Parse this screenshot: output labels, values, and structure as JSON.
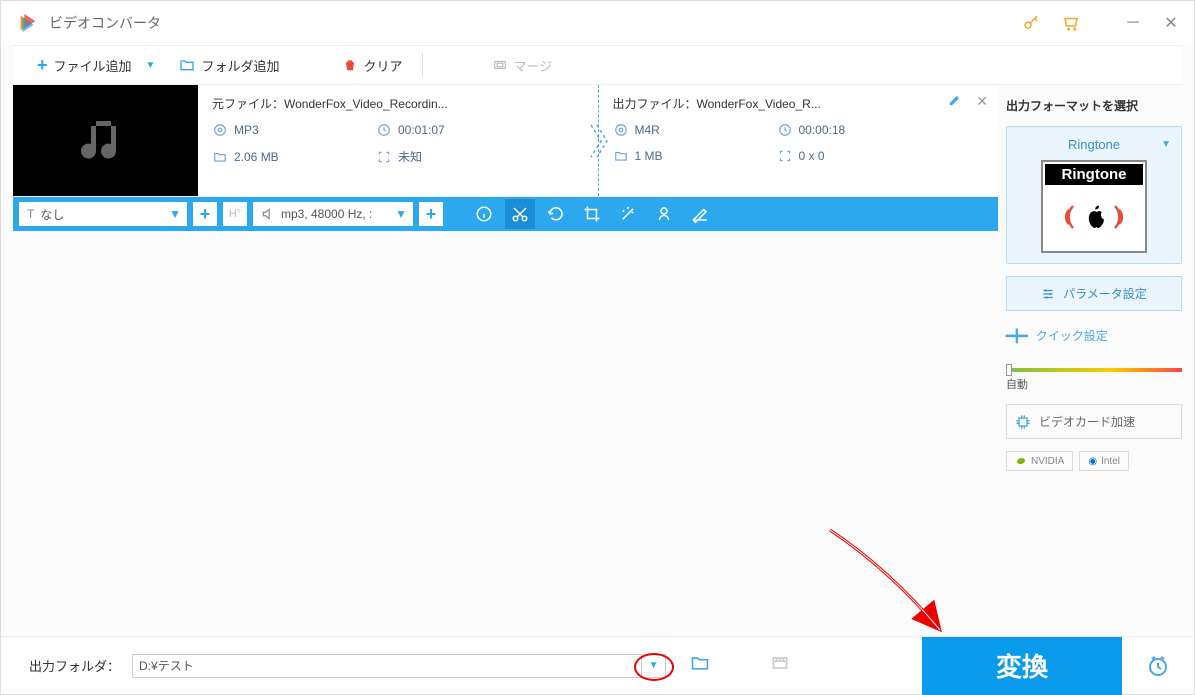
{
  "title": "ビデオコンバータ",
  "toolbar": {
    "add_file": "ファイル追加",
    "add_folder": "フォルダ追加",
    "clear": "クリア",
    "merge": "マージ"
  },
  "file": {
    "src": {
      "label": "元ファイル：",
      "name": "WonderFox_Video_Recordin...",
      "format": "MP3",
      "duration": "00:01:07",
      "size": "2.06 MB",
      "dims": "未知"
    },
    "out": {
      "label": "出力ファイル：",
      "name": "WonderFox_Video_R...",
      "format": "M4R",
      "duration": "00:00:18",
      "size": "1 MB",
      "dims": "0 x 0"
    }
  },
  "actionbar": {
    "subtitle": "なし",
    "audio": "mp3, 48000 Hz, :"
  },
  "sidebar": {
    "select_format": "出力フォーマットを選択",
    "format_name": "Ringtone",
    "format_box_label": "Ringtone",
    "param_btn": "パラメータ設定",
    "quick": "クイック設定",
    "auto": "自動",
    "gpu": "ビデオカード加速",
    "nvidia": "NVIDIA",
    "intel": "Intel"
  },
  "footer": {
    "label": "出力フォルダ：",
    "path": "D:¥テスト",
    "convert": "変換"
  }
}
